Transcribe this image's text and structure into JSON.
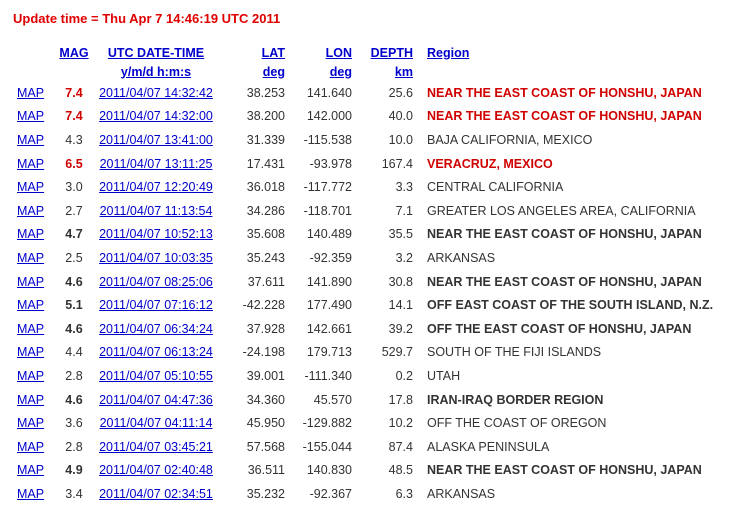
{
  "update_time": "Update time = Thu Apr 7 14:46:19 UTC 2011",
  "headers": {
    "mag": "MAG",
    "time": "UTC DATE-TIME",
    "time_sub": "y/m/d h:m:s",
    "lat": "LAT",
    "lat_sub": "deg",
    "lon": "LON",
    "lon_sub": "deg",
    "depth": "DEPTH",
    "depth_sub": "km",
    "region": "Region"
  },
  "map_label": "MAP",
  "colors": {
    "major": "#d00000",
    "link": "#0000cc",
    "text": "#333333"
  },
  "rows": [
    {
      "mag": "7.4",
      "time": "2011/04/07 14:32:42",
      "lat": "38.253",
      "lon": "141.640",
      "depth": "25.6",
      "region": "NEAR THE EAST COAST OF HONSHU, JAPAN",
      "level": "big"
    },
    {
      "mag": "7.4",
      "time": "2011/04/07 14:32:00",
      "lat": "38.200",
      "lon": "142.000",
      "depth": "40.0",
      "region": "NEAR THE EAST COAST OF HONSHU, JAPAN",
      "level": "big"
    },
    {
      "mag": "4.3",
      "time": "2011/04/07 13:41:00",
      "lat": "31.339",
      "lon": "-115.538",
      "depth": "10.0",
      "region": "BAJA CALIFORNIA, MEXICO",
      "level": "small"
    },
    {
      "mag": "6.5",
      "time": "2011/04/07 13:11:25",
      "lat": "17.431",
      "lon": "-93.978",
      "depth": "167.4",
      "region": "VERACRUZ, MEXICO",
      "level": "big"
    },
    {
      "mag": "3.0",
      "time": "2011/04/07 12:20:49",
      "lat": "36.018",
      "lon": "-117.772",
      "depth": "3.3",
      "region": "CENTRAL CALIFORNIA",
      "level": "small"
    },
    {
      "mag": "2.7",
      "time": "2011/04/07 11:13:54",
      "lat": "34.286",
      "lon": "-118.701",
      "depth": "7.1",
      "region": "GREATER LOS ANGELES AREA, CALIFORNIA",
      "level": "small"
    },
    {
      "mag": "4.7",
      "time": "2011/04/07 10:52:13",
      "lat": "35.608",
      "lon": "140.489",
      "depth": "35.5",
      "region": "NEAR THE EAST COAST OF HONSHU, JAPAN",
      "level": "med"
    },
    {
      "mag": "2.5",
      "time": "2011/04/07 10:03:35",
      "lat": "35.243",
      "lon": "-92.359",
      "depth": "3.2",
      "region": "ARKANSAS",
      "level": "small"
    },
    {
      "mag": "4.6",
      "time": "2011/04/07 08:25:06",
      "lat": "37.611",
      "lon": "141.890",
      "depth": "30.8",
      "region": "NEAR THE EAST COAST OF HONSHU, JAPAN",
      "level": "med"
    },
    {
      "mag": "5.1",
      "time": "2011/04/07 07:16:12",
      "lat": "-42.228",
      "lon": "177.490",
      "depth": "14.1",
      "region": "OFF EAST COAST OF THE SOUTH ISLAND, N.Z.",
      "level": "med"
    },
    {
      "mag": "4.6",
      "time": "2011/04/07 06:34:24",
      "lat": "37.928",
      "lon": "142.661",
      "depth": "39.2",
      "region": "OFF THE EAST COAST OF HONSHU, JAPAN",
      "level": "med"
    },
    {
      "mag": "4.4",
      "time": "2011/04/07 06:13:24",
      "lat": "-24.198",
      "lon": "179.713",
      "depth": "529.7",
      "region": "SOUTH OF THE FIJI ISLANDS",
      "level": "small"
    },
    {
      "mag": "2.8",
      "time": "2011/04/07 05:10:55",
      "lat": "39.001",
      "lon": "-111.340",
      "depth": "0.2",
      "region": "UTAH",
      "level": "small"
    },
    {
      "mag": "4.6",
      "time": "2011/04/07 04:47:36",
      "lat": "34.360",
      "lon": "45.570",
      "depth": "17.8",
      "region": "IRAN-IRAQ BORDER REGION",
      "level": "med"
    },
    {
      "mag": "3.6",
      "time": "2011/04/07 04:11:14",
      "lat": "45.950",
      "lon": "-129.882",
      "depth": "10.2",
      "region": "OFF THE COAST OF OREGON",
      "level": "small"
    },
    {
      "mag": "2.8",
      "time": "2011/04/07 03:45:21",
      "lat": "57.568",
      "lon": "-155.044",
      "depth": "87.4",
      "region": "ALASKA PENINSULA",
      "level": "small"
    },
    {
      "mag": "4.9",
      "time": "2011/04/07 02:40:48",
      "lat": "36.511",
      "lon": "140.830",
      "depth": "48.5",
      "region": "NEAR THE EAST COAST OF HONSHU, JAPAN",
      "level": "med"
    },
    {
      "mag": "3.4",
      "time": "2011/04/07 02:34:51",
      "lat": "35.232",
      "lon": "-92.367",
      "depth": "6.3",
      "region": "ARKANSAS",
      "level": "small"
    }
  ]
}
